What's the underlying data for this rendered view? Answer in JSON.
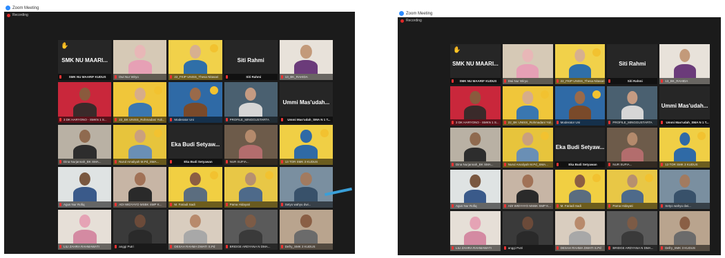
{
  "left": {
    "title": "Zoom Meeting",
    "recording": "Recording",
    "tiles": [
      {
        "label": "SMK NU MAARI...",
        "caption": "SMK NU MAARIF KUDUS",
        "kind": "name",
        "hand": true
      },
      {
        "caption": "Dwi Nur Wiryo",
        "kind": "photo",
        "bg": "#d6c9b6",
        "head": "#e8b7b7",
        "body": "#e6a0b5"
      },
      {
        "caption": "22_FKIP UNISS_Thesa Nitasari",
        "kind": "photo",
        "bg": "#f1d14a",
        "head": "#d7b08f",
        "body": "#2f6fa8",
        "logo": true
      },
      {
        "label": "Siti Rahmi",
        "caption": "Siti Rahmi",
        "kind": "name"
      },
      {
        "caption": "13_BK_RAHIDA",
        "kind": "photo",
        "bg": "#e8e2da",
        "head": "#c39a7a",
        "body": "#6b3b7a"
      },
      {
        "caption": "3 DK HARYONO - SMKN 1 S...",
        "kind": "photo",
        "bg": "#c9273b",
        "head": "#8a5a3d",
        "body": "#3a2a2a"
      },
      {
        "caption": "22_BK UNISS_Rohmadani Yuli...",
        "kind": "photo",
        "bg": "#f0c63a",
        "head": "#d7ad8a",
        "body": "#3a77b0",
        "logo": true
      },
      {
        "caption": "Moderator Uni",
        "kind": "photo",
        "bg": "#2f6aa6",
        "head": "#9a6a4a",
        "body": "#7a4a2a",
        "logo": true
      },
      {
        "caption": "PROFILE_MINGGUSTARTA",
        "kind": "photo",
        "bg": "#4a6070",
        "head": "#c59b82",
        "body": "#d6d6d6",
        "active": true
      },
      {
        "label": "Ummi Mas'udah...",
        "caption": "Ummi Mas'udah_SMA N 1 T...",
        "kind": "name"
      },
      {
        "caption": "Dina Nurjannah_BK SMA...",
        "kind": "photo",
        "bg": "#b9b1a4",
        "head": "#8f6a4f",
        "body": "#2d2d2d"
      },
      {
        "caption": "Nurul Amaliyah M.Pd_SMA...",
        "kind": "photo",
        "bg": "#e7c43c",
        "head": "#caa07e",
        "body": "#6a8fb5",
        "logo": true
      },
      {
        "label": "Eka Budi Setyaw...",
        "caption": "Eka Budi Setyawan",
        "kind": "name"
      },
      {
        "caption": "NUR SUFIA...",
        "kind": "photo",
        "bg": "#6d5b4a",
        "head": "#b48a6c",
        "body": "#b36d6d"
      },
      {
        "caption": "13 TOR SMK 3 KUDUS",
        "kind": "photo",
        "bg": "#f0cf45",
        "head": "#2f6aa6",
        "body": "#2f6aa6",
        "logo": true
      },
      {
        "caption": "Agus Nur Rofiq",
        "kind": "photo",
        "bg": "#dfe3e3",
        "head": "#7a5840",
        "body": "#3a5a8a"
      },
      {
        "caption": "ADI WIDYAYO MSBK SMP K...",
        "kind": "photo",
        "bg": "#c7b5a5",
        "head": "#a17257",
        "body": "#2a2a2a"
      },
      {
        "caption": "M. Fariadi Sadi",
        "kind": "photo",
        "bg": "#f1cf42",
        "head": "#8c5e43",
        "body": "#5b6d7f",
        "logo": true
      },
      {
        "caption": "Pama Hidayati",
        "kind": "photo",
        "bg": "#e8c746",
        "head": "#b7906f",
        "body": "#4e6a8a",
        "logo": true
      },
      {
        "caption": "Setyo wahyu dwi...",
        "kind": "photo",
        "bg": "#7a8fa0",
        "head": "#a27b60",
        "body": "#38516a"
      },
      {
        "caption": "LILI ZAHRA RAHMAWATI",
        "kind": "photo",
        "bg": "#e6dfd7",
        "head": "#e5a3b5",
        "body": "#d48aa2"
      },
      {
        "caption": "anggi Putri",
        "kind": "photo",
        "bg": "#3a3a3a",
        "head": "#6b4a39",
        "body": "#2a2a2a"
      },
      {
        "caption": "DESAH RAHMA DWATI S.Pd",
        "kind": "photo",
        "bg": "#d9cdbf",
        "head": "#b88a6c",
        "body": "#a8a8a8"
      },
      {
        "caption": "BRIDGE ARDYANA N DMA...",
        "kind": "photo",
        "bg": "#5a5a5a",
        "head": "#7c5b46",
        "body": "#3a3a3a"
      },
      {
        "caption": "Defry_SMK 3 KUDUS",
        "kind": "photo",
        "bg": "#b9a48e",
        "head": "#8a5f45",
        "body": "#6b6b6b"
      }
    ]
  },
  "right": {
    "title": "Zoom Meeting",
    "recording": "Recording",
    "tiles": [
      {
        "label": "SMK NU MAARI...",
        "caption": "SMK NU MAARIF KUDUS",
        "kind": "name",
        "hand": true
      },
      {
        "caption": "Dwi Nur Wiryo",
        "kind": "photo",
        "bg": "#d6c9b6",
        "head": "#e8b7b7",
        "body": "#e6a0b5"
      },
      {
        "caption": "22_FKIP UNISS_Thesa Nitasari",
        "kind": "photo",
        "bg": "#f1d14a",
        "head": "#d7b08f",
        "body": "#2f6fa8",
        "logo": true
      },
      {
        "label": "Siti Rahmi",
        "caption": "Siti Rahmi",
        "kind": "name"
      },
      {
        "caption": "13_BK_RAHIDA",
        "kind": "photo",
        "bg": "#e8e2da",
        "head": "#c39a7a",
        "body": "#6b3b7a"
      },
      {
        "caption": "3 DK HARYONO - SMKN 1 S...",
        "kind": "photo",
        "bg": "#c9273b",
        "head": "#8a5a3d",
        "body": "#3a2a2a"
      },
      {
        "caption": "22_BK UNISS_Rohmadani Yuli...",
        "kind": "photo",
        "bg": "#f0c63a",
        "head": "#d7ad8a",
        "body": "#3a77b0",
        "logo": true
      },
      {
        "caption": "Moderator Uni",
        "kind": "photo",
        "bg": "#2f6aa6",
        "head": "#9a6a4a",
        "body": "#7a4a2a",
        "logo": true
      },
      {
        "caption": "PROFILE_MINGGUSTARTA",
        "kind": "photo",
        "bg": "#4a6070",
        "head": "#c59b82",
        "body": "#d6d6d6",
        "active": true
      },
      {
        "label": "Ummi Mas'udah...",
        "caption": "Ummi Mas'udah_SMA N 1 T...",
        "kind": "name"
      },
      {
        "caption": "Dina Nurjannah_BK SMA...",
        "kind": "photo",
        "bg": "#b9b1a4",
        "head": "#8f6a4f",
        "body": "#2d2d2d"
      },
      {
        "caption": "Nurul Amaliyah M.Pd_SMA...",
        "kind": "photo",
        "bg": "#e7c43c",
        "head": "#caa07e",
        "body": "#6a8fb5",
        "logo": true
      },
      {
        "label": "Eka Budi Setyaw...",
        "caption": "Eka Budi Setyawan",
        "kind": "name"
      },
      {
        "caption": "NUR SUFIA...",
        "kind": "photo",
        "bg": "#6d5b4a",
        "head": "#b48a6c",
        "body": "#b36d6d"
      },
      {
        "caption": "13 TOR SMK 3 KUDUS",
        "kind": "photo",
        "bg": "#f0cf45",
        "head": "#2f6aa6",
        "body": "#2f6aa6",
        "logo": true
      },
      {
        "caption": "Agus Nur Rofiq",
        "kind": "photo",
        "bg": "#dfe3e3",
        "head": "#7a5840",
        "body": "#3a5a8a"
      },
      {
        "caption": "ADI WIDYAYO MSBK SMP K...",
        "kind": "photo",
        "bg": "#c7b5a5",
        "head": "#a17257",
        "body": "#2a2a2a"
      },
      {
        "caption": "M. Fariadi Sadi",
        "kind": "photo",
        "bg": "#f1cf42",
        "head": "#8c5e43",
        "body": "#5b6d7f",
        "logo": true
      },
      {
        "caption": "Pama Hidayati",
        "kind": "photo",
        "bg": "#e8c746",
        "head": "#b7906f",
        "body": "#4e6a8a",
        "logo": true
      },
      {
        "caption": "Setyo wahyu dwi...",
        "kind": "photo",
        "bg": "#7a8fa0",
        "head": "#a27b60",
        "body": "#38516a"
      },
      {
        "caption": "LILI ZAHRA RAHMAWATI",
        "kind": "photo",
        "bg": "#e6dfd7",
        "head": "#e5a3b5",
        "body": "#d48aa2"
      },
      {
        "caption": "anggi Putri",
        "kind": "photo",
        "bg": "#3a3a3a",
        "head": "#6b4a39",
        "body": "#2a2a2a"
      },
      {
        "caption": "DESAH RAHMA DWATI S.Pd",
        "kind": "photo",
        "bg": "#d9cdbf",
        "head": "#b88a6c",
        "body": "#a8a8a8"
      },
      {
        "caption": "BRIDGE ARDYANA N DMA...",
        "kind": "photo",
        "bg": "#5a5a5a",
        "head": "#7c5b46",
        "body": "#3a3a3a"
      },
      {
        "caption": "Defry_SMK 3 KUDUS",
        "kind": "photo",
        "bg": "#b9a48e",
        "head": "#8a5f45",
        "body": "#6b6b6b"
      }
    ]
  }
}
